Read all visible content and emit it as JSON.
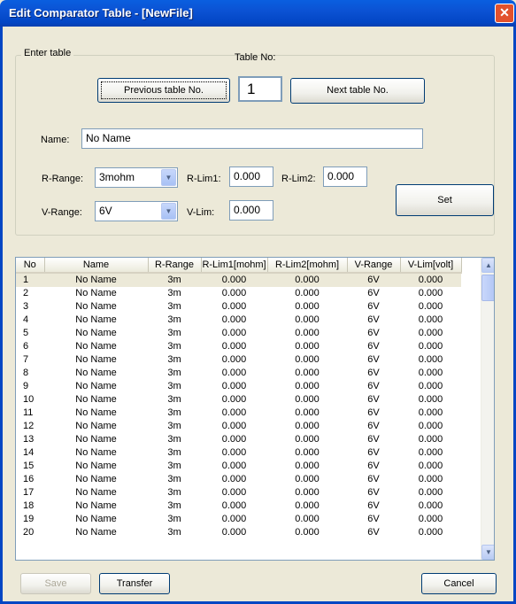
{
  "window": {
    "title": "Edit Comparator Table - [NewFile]",
    "close_glyph": "✕"
  },
  "enter_table": {
    "group_label": "Enter table",
    "table_no_label": "Table No:",
    "table_no_value": "1",
    "prev_button": "Previous table No.",
    "next_button": "Next table No.",
    "name_label": "Name:",
    "name_value": "No Name",
    "r_range_label": "R-Range:",
    "r_range_value": "3mohm",
    "r_lim1_label": "R-Lim1:",
    "r_lim1_value": "0.000",
    "r_lim2_label": "R-Lim2:",
    "r_lim2_value": "0.000",
    "v_range_label": "V-Range:",
    "v_range_value": "6V",
    "v_lim_label": "V-Lim:",
    "v_lim_value": "0.000",
    "set_button": "Set"
  },
  "table": {
    "columns": [
      "No",
      "Name",
      "R-Range",
      "R-Lim1[mohm]",
      "R-Lim2[mohm]",
      "V-Range",
      "V-Lim[volt]"
    ],
    "rows": [
      [
        "1",
        "No Name",
        "3m",
        "0.000",
        "0.000",
        "6V",
        "0.000"
      ],
      [
        "2",
        "No Name",
        "3m",
        "0.000",
        "0.000",
        "6V",
        "0.000"
      ],
      [
        "3",
        "No Name",
        "3m",
        "0.000",
        "0.000",
        "6V",
        "0.000"
      ],
      [
        "4",
        "No Name",
        "3m",
        "0.000",
        "0.000",
        "6V",
        "0.000"
      ],
      [
        "5",
        "No Name",
        "3m",
        "0.000",
        "0.000",
        "6V",
        "0.000"
      ],
      [
        "6",
        "No Name",
        "3m",
        "0.000",
        "0.000",
        "6V",
        "0.000"
      ],
      [
        "7",
        "No Name",
        "3m",
        "0.000",
        "0.000",
        "6V",
        "0.000"
      ],
      [
        "8",
        "No Name",
        "3m",
        "0.000",
        "0.000",
        "6V",
        "0.000"
      ],
      [
        "9",
        "No Name",
        "3m",
        "0.000",
        "0.000",
        "6V",
        "0.000"
      ],
      [
        "10",
        "No Name",
        "3m",
        "0.000",
        "0.000",
        "6V",
        "0.000"
      ],
      [
        "11",
        "No Name",
        "3m",
        "0.000",
        "0.000",
        "6V",
        "0.000"
      ],
      [
        "12",
        "No Name",
        "3m",
        "0.000",
        "0.000",
        "6V",
        "0.000"
      ],
      [
        "13",
        "No Name",
        "3m",
        "0.000",
        "0.000",
        "6V",
        "0.000"
      ],
      [
        "14",
        "No Name",
        "3m",
        "0.000",
        "0.000",
        "6V",
        "0.000"
      ],
      [
        "15",
        "No Name",
        "3m",
        "0.000",
        "0.000",
        "6V",
        "0.000"
      ],
      [
        "16",
        "No Name",
        "3m",
        "0.000",
        "0.000",
        "6V",
        "0.000"
      ],
      [
        "17",
        "No Name",
        "3m",
        "0.000",
        "0.000",
        "6V",
        "0.000"
      ],
      [
        "18",
        "No Name",
        "3m",
        "0.000",
        "0.000",
        "6V",
        "0.000"
      ],
      [
        "19",
        "No Name",
        "3m",
        "0.000",
        "0.000",
        "6V",
        "0.000"
      ],
      [
        "20",
        "No Name",
        "3m",
        "0.000",
        "0.000",
        "6V",
        "0.000"
      ]
    ]
  },
  "footer": {
    "save_button": "Save",
    "transfer_button": "Transfer",
    "cancel_button": "Cancel"
  },
  "colors": {
    "titlebar": "#0346c4",
    "dialog_bg": "#ece9d8",
    "close_button": "#e2512d"
  }
}
